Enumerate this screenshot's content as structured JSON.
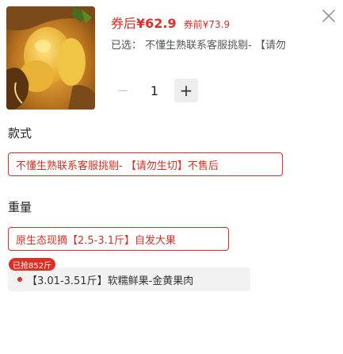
{
  "product": {
    "after_coupon_label": "券后",
    "after_coupon_price": "¥62.9",
    "before_coupon_label": "券前",
    "before_coupon_price": "¥73.9",
    "selected_text": "已选： 不懂生熟联系客服挑剔- 【请勿"
  },
  "quantity": {
    "value": "1",
    "plus": "+",
    "minus": "−"
  },
  "sections": {
    "style": {
      "title": "款式",
      "options": [
        "不懂生熟联系客服挑剔- 【请勿生切】不售后"
      ]
    },
    "weight": {
      "title": "重量",
      "options": [
        {
          "label": "原生态现摘【2.5-3.1斤】自发大果"
        },
        {
          "label": "【3.01-3.51斤】软糯鲜果-金黄果肉",
          "badge": "已抢852斤"
        }
      ]
    }
  },
  "icons": {
    "close": "close-icon",
    "product_image": "durian-image"
  },
  "colors": {
    "accent": "#e02e24",
    "chip_bg": "#f2f2f2"
  }
}
